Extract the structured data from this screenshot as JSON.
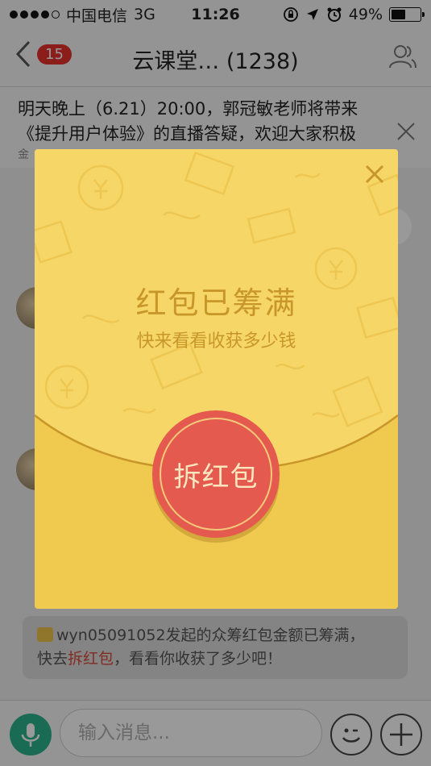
{
  "status_bar": {
    "carrier": "中国电信",
    "network": "3G",
    "time": "11:26",
    "battery": "49%",
    "battery_level": 0.49
  },
  "nav": {
    "unread_count": "15",
    "title": "云课堂… (1238)"
  },
  "announcement": {
    "line1": "明天晚上（6.21）20:00，郭冠敏老师将带来",
    "line2": "《提升用户体验》的直播答疑，欢迎大家积极",
    "line3": "金"
  },
  "system_message": {
    "user": "wyn05091052",
    "text1": "发起的众筹红包金额已筹满，",
    "text2_before": "快去",
    "link": "拆红包",
    "text2_after": "，看看你收获了多少吧！"
  },
  "input": {
    "placeholder": "输入消息..."
  },
  "envelope": {
    "title": "红包已筹满",
    "subtitle": "快来看看收获多少钱",
    "open_label": "拆红包"
  },
  "colors": {
    "envelope": "#f6d461",
    "envelope_text": "#c9962a",
    "open_button": "#e55a4e",
    "badge": "#e8312e",
    "voice": "#2bb38a"
  }
}
